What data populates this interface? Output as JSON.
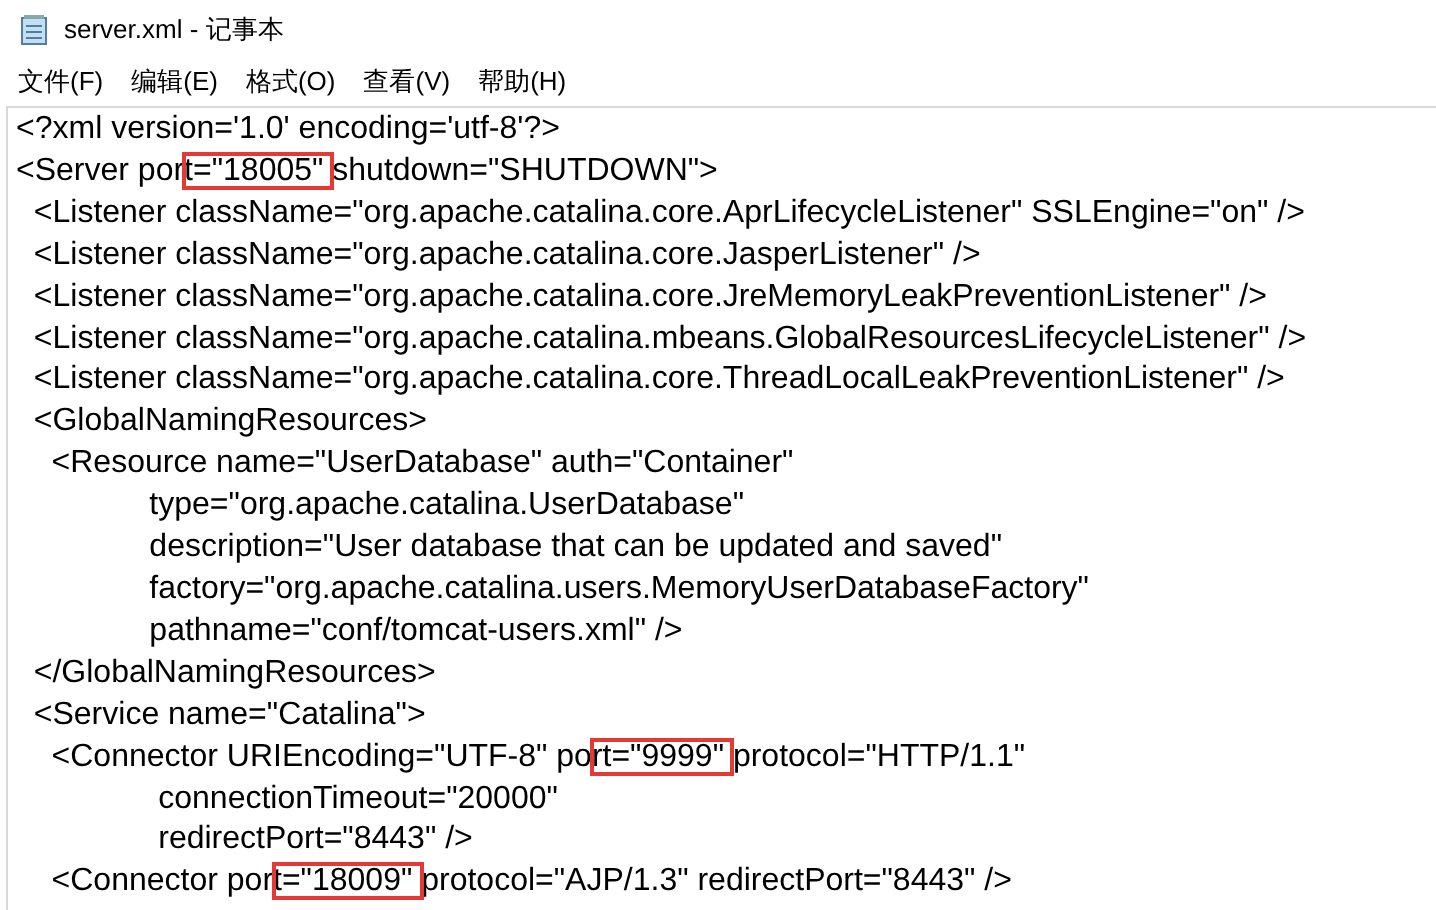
{
  "window": {
    "title": "server.xml - 记事本"
  },
  "menu": [
    "文件(F)",
    "编辑(E)",
    "格式(O)",
    "查看(V)",
    "帮助(H)"
  ],
  "lines": [
    {
      "segments": [
        {
          "text": "<?xml version='1.0' encoding='utf-8'?>",
          "boxed": false
        }
      ]
    },
    {
      "segments": [
        {
          "text": "<Server por",
          "boxed": false
        },
        {
          "text": "t=\"18005\" ",
          "boxed": true
        },
        {
          "text": "shutdown=\"SHUTDOWN\">",
          "boxed": false
        }
      ]
    },
    {
      "segments": [
        {
          "text": "  <Listener className=\"org.apache.catalina.core.AprLifecycleListener\" SSLEngine=\"on\" />",
          "boxed": false
        }
      ]
    },
    {
      "segments": [
        {
          "text": "  <Listener className=\"org.apache.catalina.core.JasperListener\" />",
          "boxed": false
        }
      ]
    },
    {
      "segments": [
        {
          "text": "  <Listener className=\"org.apache.catalina.core.JreMemoryLeakPreventionListener\" />",
          "boxed": false
        }
      ]
    },
    {
      "segments": [
        {
          "text": "  <Listener className=\"org.apache.catalina.mbeans.GlobalResourcesLifecycleListener\" />",
          "boxed": false
        }
      ]
    },
    {
      "segments": [
        {
          "text": "  <Listener className=\"org.apache.catalina.core.ThreadLocalLeakPreventionListener\" />",
          "boxed": false
        }
      ]
    },
    {
      "segments": [
        {
          "text": "  <GlobalNamingResources>",
          "boxed": false
        }
      ]
    },
    {
      "segments": [
        {
          "text": "    <Resource name=\"UserDatabase\" auth=\"Container\"",
          "boxed": false
        }
      ]
    },
    {
      "segments": [
        {
          "text": "               type=\"org.apache.catalina.UserDatabase\"",
          "boxed": false
        }
      ]
    },
    {
      "segments": [
        {
          "text": "               description=\"User database that can be updated and saved\"",
          "boxed": false
        }
      ]
    },
    {
      "segments": [
        {
          "text": "               factory=\"org.apache.catalina.users.MemoryUserDatabaseFactory\"",
          "boxed": false
        }
      ]
    },
    {
      "segments": [
        {
          "text": "               pathname=\"conf/tomcat-users.xml\" />",
          "boxed": false
        }
      ]
    },
    {
      "segments": [
        {
          "text": "  </GlobalNamingResources>",
          "boxed": false
        }
      ]
    },
    {
      "segments": [
        {
          "text": "  <Service name=\"Catalina\">",
          "boxed": false
        }
      ]
    },
    {
      "segments": [
        {
          "text": "    <Connector URIEncoding=\"UTF-8\" po",
          "boxed": false
        },
        {
          "text": "rt=\"9999\" ",
          "boxed": true
        },
        {
          "text": "protocol=\"HTTP/1.1\"",
          "boxed": false
        }
      ]
    },
    {
      "segments": [
        {
          "text": "                connectionTimeout=\"20000\"",
          "boxed": false
        }
      ]
    },
    {
      "segments": [
        {
          "text": "                redirectPort=\"8443\" />",
          "boxed": false
        }
      ]
    },
    {
      "segments": [
        {
          "text": "    <Connector por",
          "boxed": false
        },
        {
          "text": "t=\"18009\" ",
          "boxed": true
        },
        {
          "text": "protocol=\"AJP/1.3\" redirectPort=\"8443\" />",
          "boxed": false
        }
      ]
    }
  ]
}
